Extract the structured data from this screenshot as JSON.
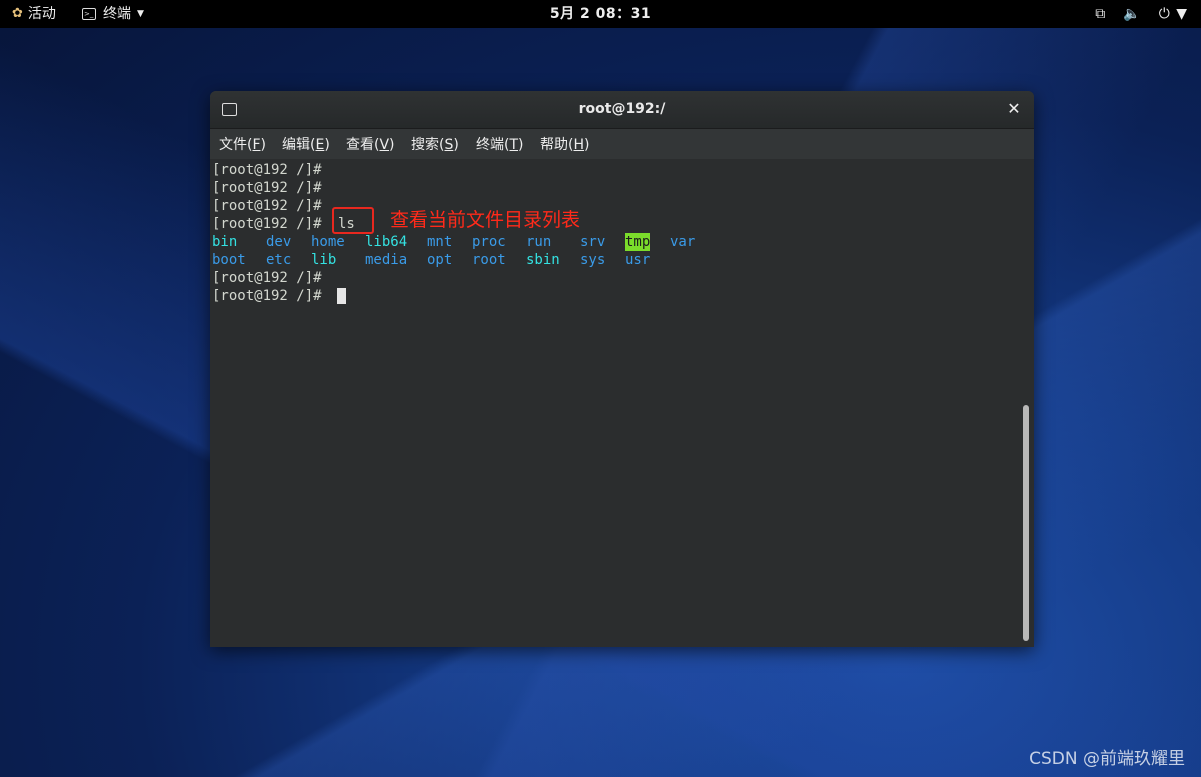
{
  "topbar": {
    "activities": "活动",
    "app_name": "终端",
    "clock": "5月 2 08：31",
    "status_icons": [
      "network-icon",
      "volume-icon",
      "power-icon"
    ]
  },
  "window": {
    "title": "root@192:/",
    "close_label": "✕",
    "menu": [
      {
        "label": "文件(",
        "key": "F",
        "tail": ")"
      },
      {
        "label": "编辑(",
        "key": "E",
        "tail": ")"
      },
      {
        "label": "查看(",
        "key": "V",
        "tail": ")"
      },
      {
        "label": "搜索(",
        "key": "S",
        "tail": ")"
      },
      {
        "label": "终端(",
        "key": "T",
        "tail": ")"
      },
      {
        "label": "帮助(",
        "key": "H",
        "tail": ")"
      }
    ]
  },
  "terminal": {
    "prompt": "[root@192 /]#",
    "command": "ls",
    "ls_row1": [
      "bin",
      "dev",
      "home",
      "lib64",
      "mnt",
      "proc",
      "run",
      "srv",
      "tmp",
      "var"
    ],
    "ls_row2": [
      "boot",
      "etc",
      "lib",
      "media",
      "opt",
      "root",
      "sbin",
      "sys",
      "usr"
    ]
  },
  "annotation": "查看当前文件目录列表",
  "watermark": "CSDN @前端玖耀里",
  "colors": {
    "symlink_cyan": "#34e2e2",
    "directory_blue": "#3a9be8",
    "tmp_highlight": "#7bdc2b",
    "annotation_red": "#ff2a1a"
  }
}
